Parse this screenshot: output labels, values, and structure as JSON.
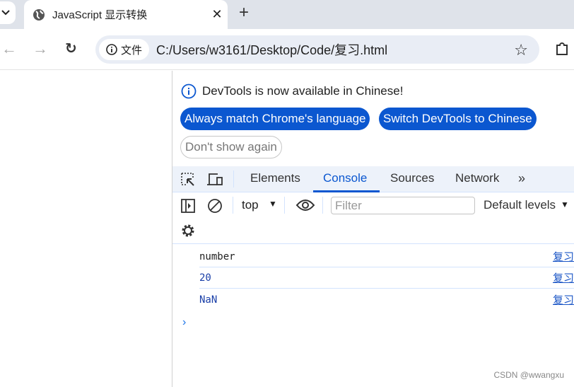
{
  "browser": {
    "tab_title": "JavaScript 显示转换",
    "address_chip": "文件",
    "url": "C:/Users/w3161/Desktop/Code/复习.html"
  },
  "devtools": {
    "notice": "DevTools is now available in Chinese!",
    "buttons": {
      "match": "Always match Chrome's language",
      "switch": "Switch DevTools to Chinese",
      "dismiss": "Don't show again"
    },
    "tabs": [
      "Elements",
      "Console",
      "Sources",
      "Network"
    ],
    "active_tab": "Console",
    "context": "top",
    "filter_placeholder": "Filter",
    "levels": "Default levels",
    "logs": [
      {
        "text": "number",
        "source": "复习"
      },
      {
        "text": "20",
        "source": "复习"
      },
      {
        "text": "NaN",
        "source": "复习"
      }
    ]
  },
  "watermark": "CSDN @wwangxu",
  "colors": {
    "accent": "#0b57d0",
    "number": "#1a3fa8"
  }
}
